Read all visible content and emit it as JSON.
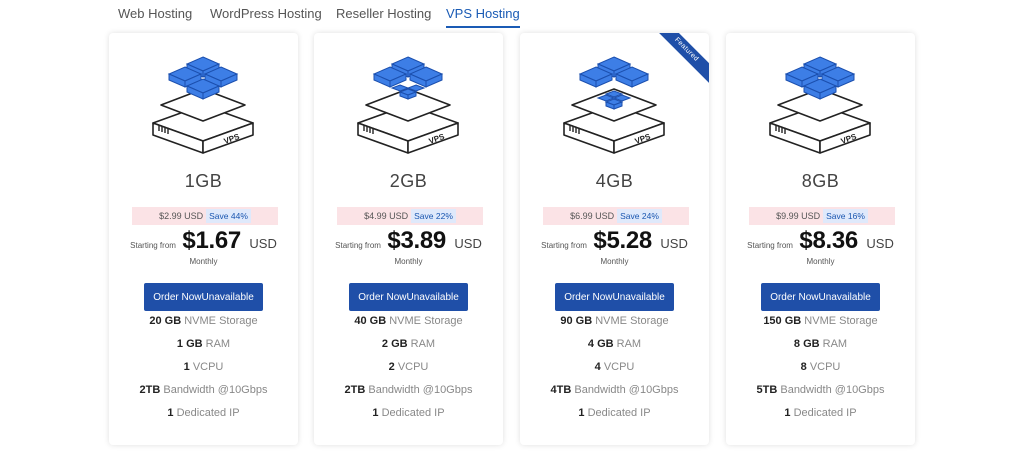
{
  "tabs": [
    {
      "label": "Web Hosting",
      "active": false
    },
    {
      "label": "WordPress Hosting",
      "active": false
    },
    {
      "label": "Reseller Hosting",
      "active": false
    },
    {
      "label": "VPS Hosting",
      "active": true
    }
  ],
  "colors": {
    "accent": "#1f4fa8",
    "tab_active": "#1a5bb5",
    "old_price_bg": "#fbe3e6",
    "save_badge_bg": "#dfe9fb",
    "cube_blue": "#3d7ee6"
  },
  "plans": [
    {
      "name": "1GB",
      "old_price": "$2.99 USD",
      "save": "Save 44%",
      "starting_label": "Starting from",
      "price": "$1.67",
      "currency": "USD",
      "period": "Monthly",
      "button": "Order NowUnavailable",
      "featured": false,
      "illustration_icon": "vps-server-cubes-icon",
      "features": [
        {
          "value": "20 GB",
          "label": "NVME Storage"
        },
        {
          "value": "1 GB",
          "label": "RAM"
        },
        {
          "value": "1",
          "label": "VCPU"
        },
        {
          "value": "2TB",
          "label": "Bandwidth @10Gbps"
        },
        {
          "value": "1",
          "label": "Dedicated IP"
        }
      ]
    },
    {
      "name": "2GB",
      "old_price": "$4.99 USD",
      "save": "Save 22%",
      "starting_label": "Starting from",
      "price": "$3.89",
      "currency": "USD",
      "period": "Monthly",
      "button": "Order NowUnavailable",
      "featured": false,
      "illustration_icon": "vps-server-cubes-icon",
      "features": [
        {
          "value": "40 GB",
          "label": "NVME Storage"
        },
        {
          "value": "2 GB",
          "label": "RAM"
        },
        {
          "value": "2",
          "label": "VCPU"
        },
        {
          "value": "2TB",
          "label": "Bandwidth @10Gbps"
        },
        {
          "value": "1",
          "label": "Dedicated IP"
        }
      ]
    },
    {
      "name": "4GB",
      "old_price": "$6.99 USD",
      "save": "Save 24%",
      "starting_label": "Starting from",
      "price": "$5.28",
      "currency": "USD",
      "period": "Monthly",
      "button": "Order NowUnavailable",
      "featured": true,
      "ribbon": "Featured",
      "illustration_icon": "vps-server-cubes-icon",
      "features": [
        {
          "value": "90 GB",
          "label": "NVME Storage"
        },
        {
          "value": "4 GB",
          "label": "RAM"
        },
        {
          "value": "4",
          "label": "VCPU"
        },
        {
          "value": "4TB",
          "label": "Bandwidth @10Gbps"
        },
        {
          "value": "1",
          "label": "Dedicated IP"
        }
      ]
    },
    {
      "name": "8GB",
      "old_price": "$9.99 USD",
      "save": "Save 16%",
      "starting_label": "Starting from",
      "price": "$8.36",
      "currency": "USD",
      "period": "Monthly",
      "button": "Order NowUnavailable",
      "featured": false,
      "illustration_icon": "vps-server-cubes-icon",
      "features": [
        {
          "value": "150 GB",
          "label": "NVME Storage"
        },
        {
          "value": "8 GB",
          "label": "RAM"
        },
        {
          "value": "8",
          "label": "VCPU"
        },
        {
          "value": "5TB",
          "label": "Bandwidth @10Gbps"
        },
        {
          "value": "1",
          "label": "Dedicated IP"
        }
      ]
    }
  ]
}
